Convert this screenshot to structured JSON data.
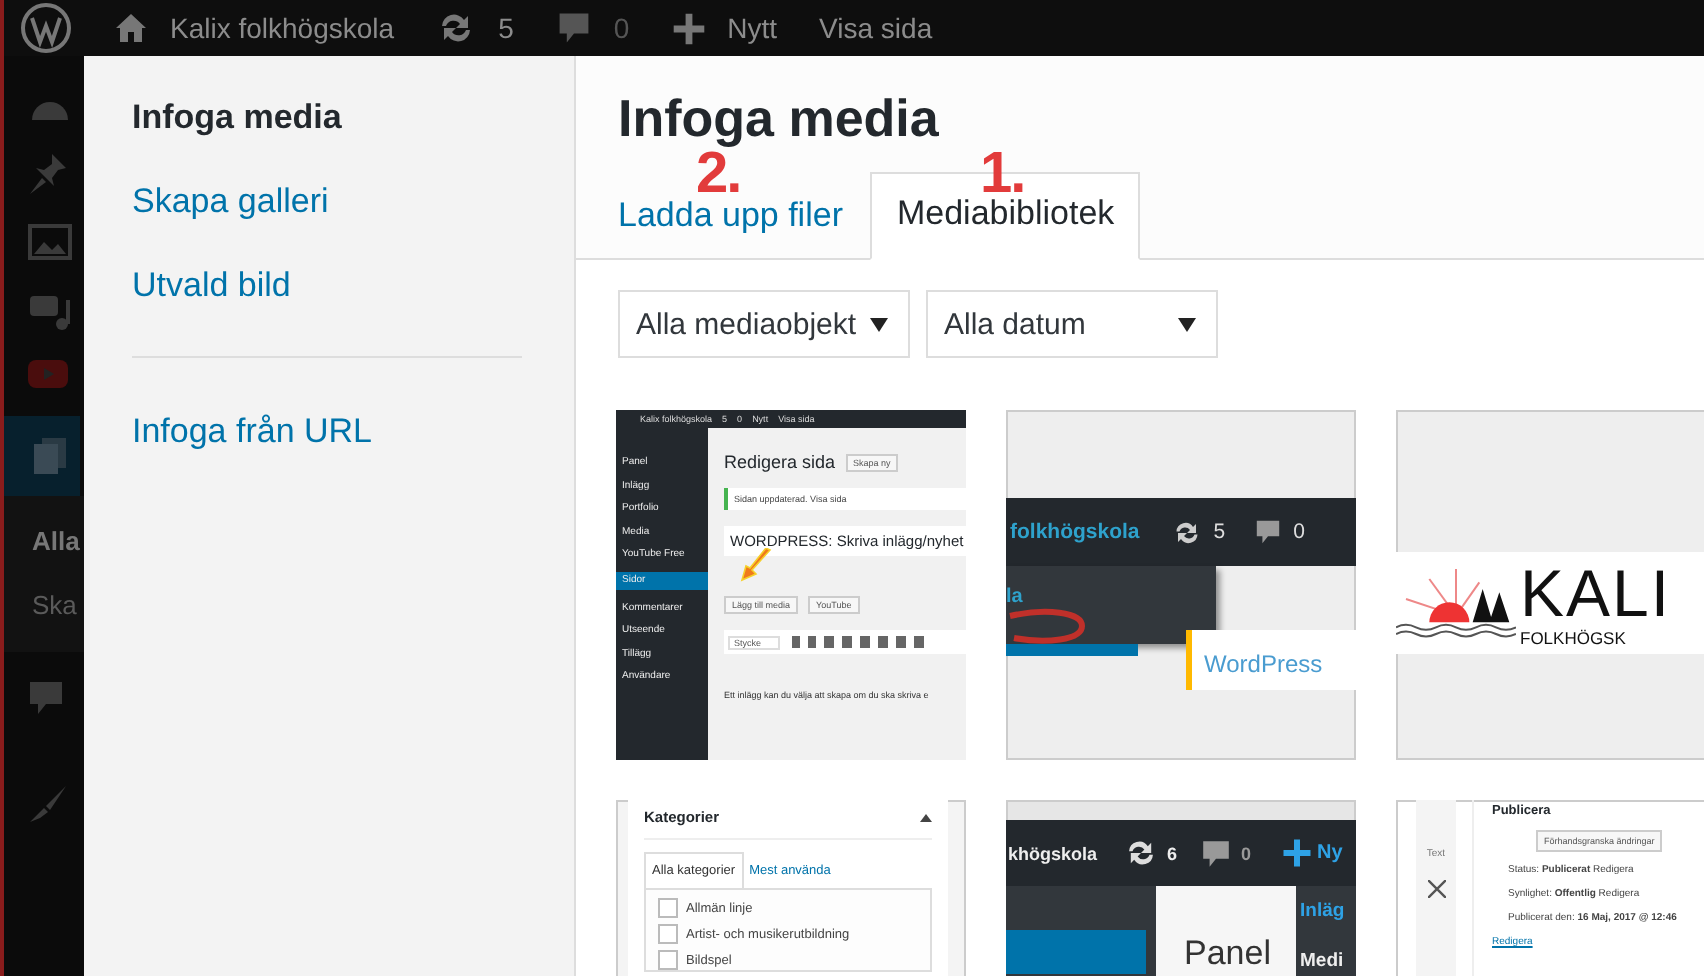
{
  "admin_bar": {
    "site_name": "Kalix folkhögskola",
    "updates": "5",
    "comments": "0",
    "new_label": "Nytt",
    "view_label": "Visa sida"
  },
  "admin_menu": {
    "submenu": [
      "Alla",
      "Ska"
    ]
  },
  "modal_menu": {
    "items": [
      {
        "label": "Infoga media",
        "selected": true,
        "kind": "link"
      },
      {
        "label": "Skapa galleri",
        "selected": false,
        "kind": "link"
      },
      {
        "label": "Utvald bild",
        "selected": false,
        "kind": "link"
      },
      {
        "kind": "separator"
      },
      {
        "label": "Infoga från URL",
        "selected": false,
        "kind": "link"
      }
    ]
  },
  "modal": {
    "title": "Infoga media",
    "tabs": [
      {
        "label": "Ladda upp filer",
        "selected": false
      },
      {
        "label": "Mediabibliotek",
        "selected": true
      }
    ],
    "annotations": [
      {
        "text": "2."
      },
      {
        "text": "1."
      }
    ],
    "filters": [
      {
        "value": "Alla mediaobjekt"
      },
      {
        "value": "Alla datum"
      }
    ],
    "media": [
      {
        "kind": "editor",
        "bar": [
          "Kalix folkhögskola",
          "5",
          "0",
          "Nytt",
          "Visa sida"
        ],
        "menu": [
          {
            "label": "Panel",
            "selected": false
          },
          {
            "label": "Inlägg",
            "selected": false
          },
          {
            "label": "Portfolio",
            "selected": false
          },
          {
            "label": "Media",
            "selected": false
          },
          {
            "label": "YouTube Free",
            "selected": false
          },
          {
            "label": "Sidor",
            "selected": true
          },
          {
            "label": "Kommentarer",
            "selected": false
          },
          {
            "label": "Utseende",
            "selected": false
          },
          {
            "label": "Tillägg",
            "selected": false
          },
          {
            "label": "Användare",
            "selected": false
          }
        ],
        "heading": "Redigera sida",
        "heading_button": "Skapa ny",
        "notice": "Sidan uppdaterad. Visa sida",
        "post_title": "WORDPRESS: Skriva inlägg/nyhet",
        "buttons": [
          "Lägg till media",
          "YouTube"
        ],
        "format": "Stycke",
        "body": "Ett inlägg kan du välja att skapa om du ska skriva e"
      },
      {
        "kind": "adminbar",
        "site": "folkhögskola",
        "updates": "5",
        "comments": "0",
        "menu_text": "la",
        "content_text": "WordPress"
      },
      {
        "kind": "logo",
        "name": "KALI",
        "subtitle": "FOLKHÖGSK"
      },
      {
        "kind": "categories",
        "title": "Kategorier",
        "tabs": [
          {
            "label": "Alla kategorier",
            "selected": true
          },
          {
            "label": "Mest använda",
            "selected": false
          }
        ],
        "items": [
          {
            "label": "Allmän linje",
            "checked": false
          },
          {
            "label": "Artist- och musikerutbildning",
            "checked": false
          },
          {
            "label": "Bildspel",
            "checked": false
          }
        ]
      },
      {
        "kind": "panel",
        "site": "khögskola",
        "updates": "6",
        "comments": "0",
        "new_label": "Ny",
        "flyout": "Panel",
        "menu": [
          "Inläg",
          "Medi"
        ]
      },
      {
        "kind": "publish",
        "side_tab": "Text",
        "title": "Publicera",
        "preview_button": "Förhandsgranska ändringar",
        "rows": [
          "Status: **Publicerat** Redigera",
          "Synlighet: **Offentlig** Redigera",
          "Publicerat den: **16 Maj, 2017 @ 12:46**"
        ],
        "link": "Redigera"
      }
    ]
  }
}
